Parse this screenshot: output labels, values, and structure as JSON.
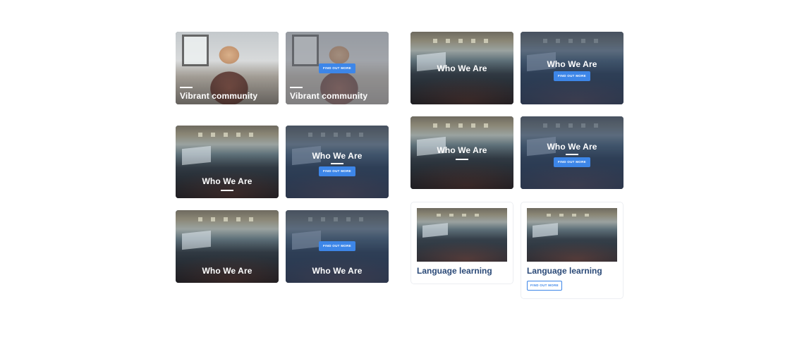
{
  "cards": {
    "vibrant_title": "Vibrant community",
    "who_title": "Who We Are",
    "lang_title": "Language learning",
    "button_label": "FIND OUT MORE"
  },
  "colors": {
    "button_blue": "#3d86e8",
    "title_navy": "#2b4a78",
    "overlay_blue": "#283e60"
  }
}
